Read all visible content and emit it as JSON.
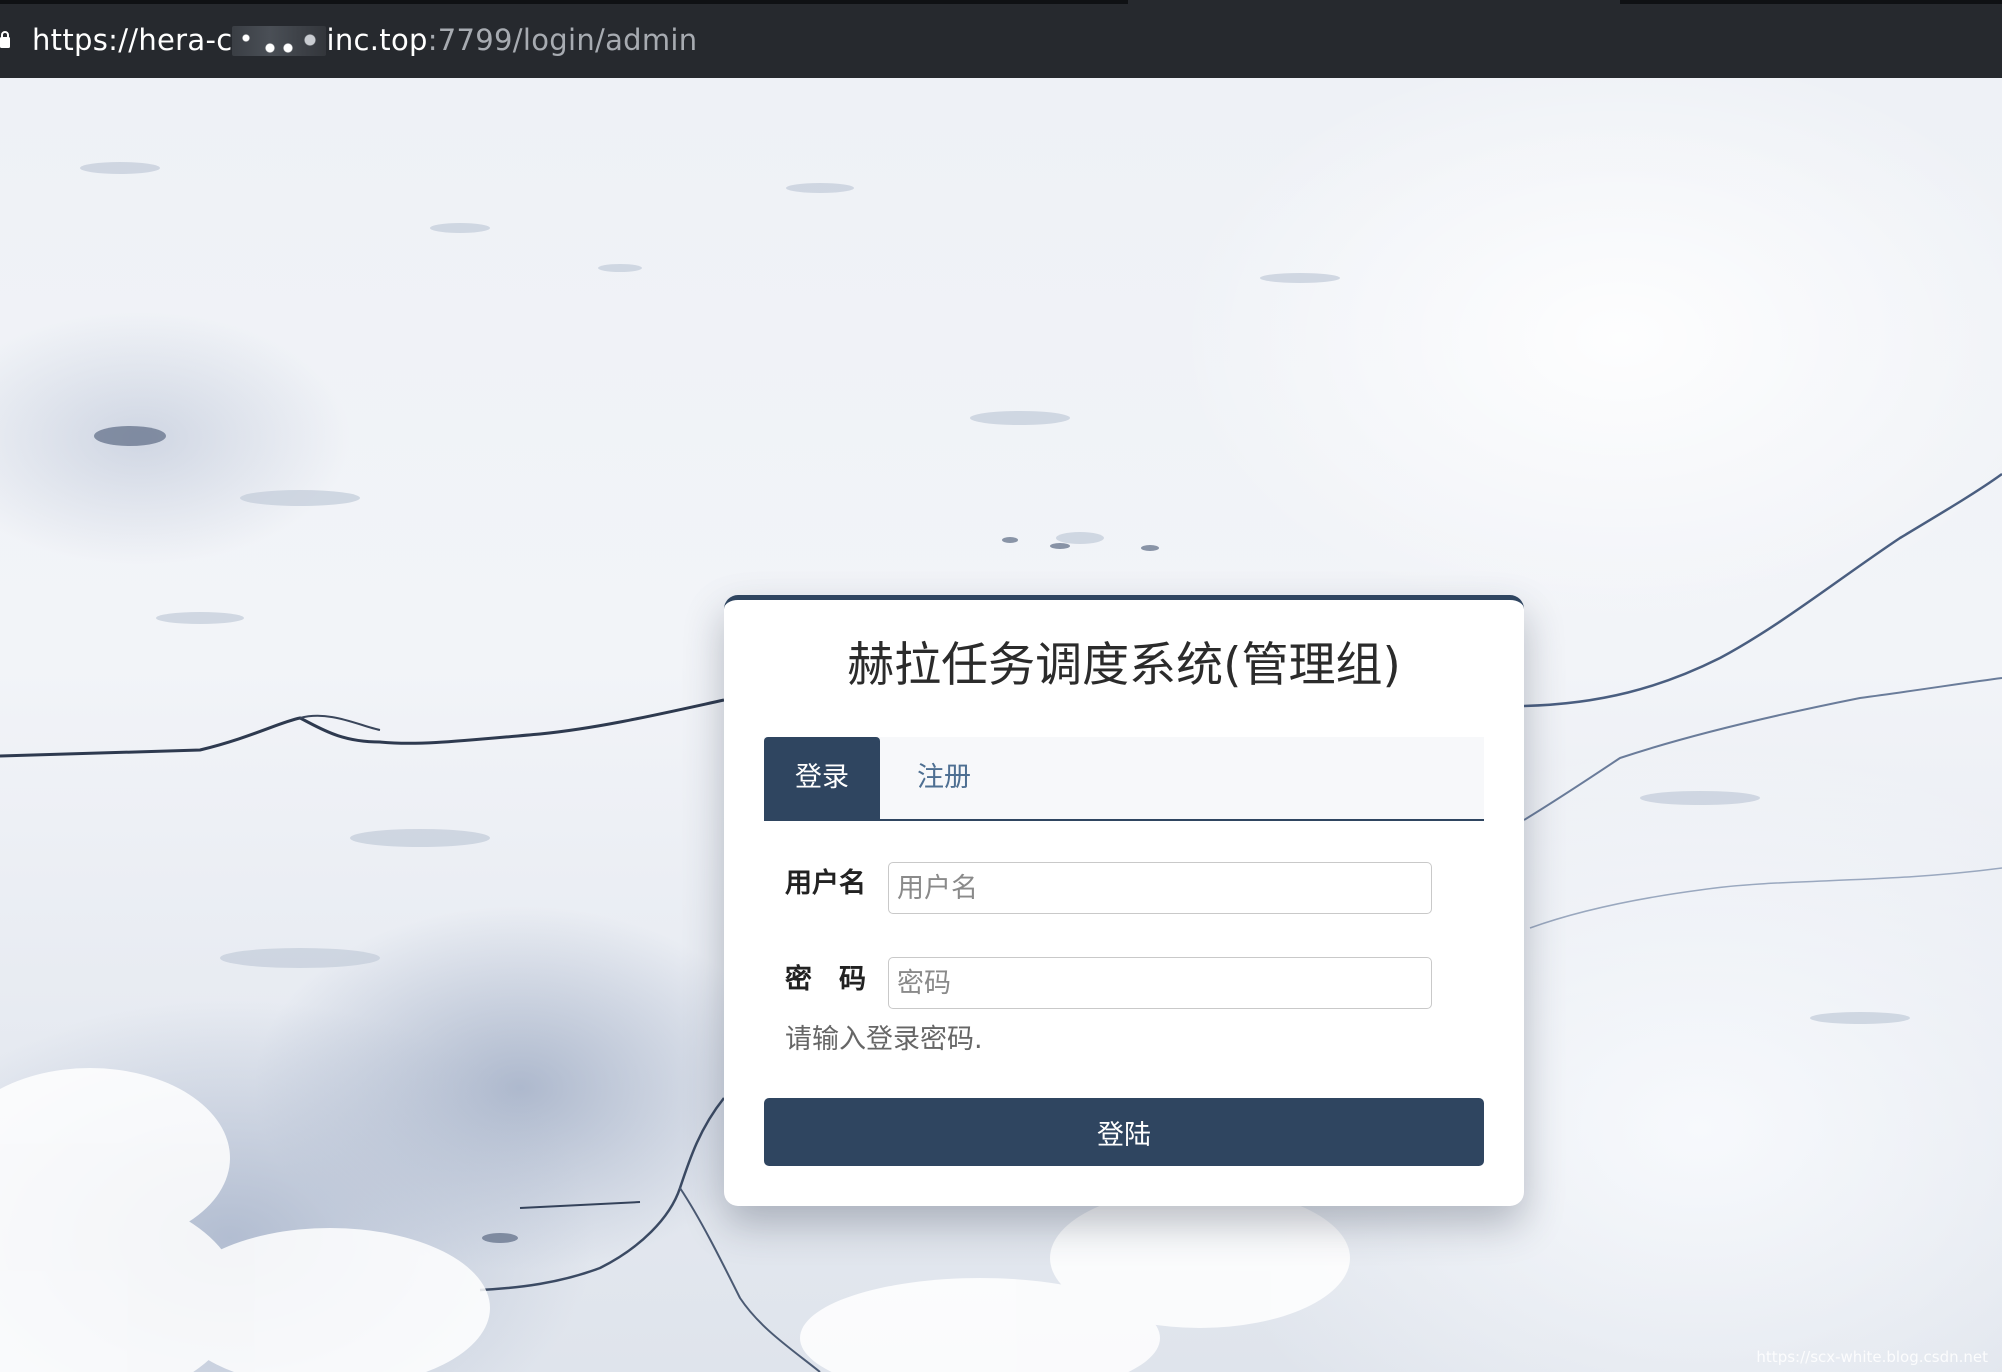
{
  "browser": {
    "url_prefix": "https://hera-c",
    "url_host_suffix": "inc.top",
    "url_path": ":7799/login/admin"
  },
  "login": {
    "title": "赫拉任务调度系统(管理组)",
    "tabs": [
      {
        "label": "登录",
        "active": true
      },
      {
        "label": "注册",
        "active": false
      }
    ],
    "username_label": "用户名",
    "username_placeholder": "用户名",
    "username_value": "",
    "password_label": "密　码",
    "password_placeholder": "密码",
    "password_value": "",
    "password_help": "请输入登录密码.",
    "submit_label": "登陆"
  },
  "watermark": "https://scx-white.blog.csdn.net",
  "colors": {
    "primary": "#2f4560",
    "tab_inactive_text": "#4e6f92",
    "address_bar": "#26292e"
  }
}
